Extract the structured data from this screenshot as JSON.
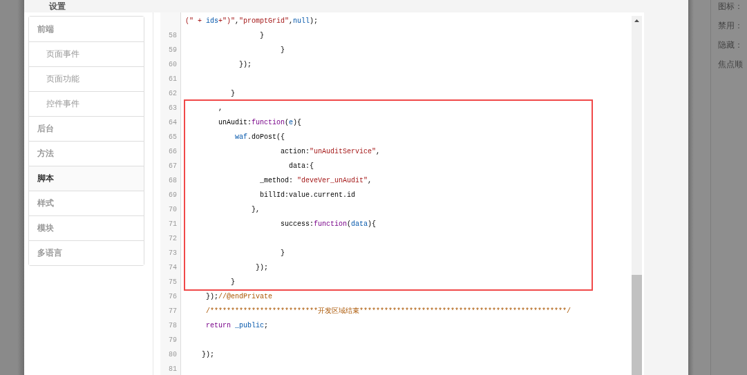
{
  "dialog": {
    "title": "设置"
  },
  "sidebar": {
    "items": [
      {
        "label": "前端",
        "selected": false,
        "children": [
          {
            "label": "页面事件",
            "selected": false
          },
          {
            "label": "页面功能",
            "selected": false
          },
          {
            "label": "控件事件",
            "selected": false
          }
        ]
      },
      {
        "label": "后台",
        "selected": false
      },
      {
        "label": "方法",
        "selected": false
      },
      {
        "label": "脚本",
        "selected": true
      },
      {
        "label": "样式",
        "selected": false
      },
      {
        "label": "模块",
        "selected": false
      },
      {
        "label": "多语言",
        "selected": false
      }
    ]
  },
  "editor": {
    "blocks": [
      {
        "highlighted": false,
        "lines": [
          {
            "segments": [
              {
                "kind": "string",
                "text": "(\" + "
              },
              {
                "kind": "ident",
                "text": "ids"
              },
              {
                "kind": "string",
                "text": "+\")\""
              },
              {
                "kind": "plain",
                "text": ","
              },
              {
                "kind": "string",
                "text": "\"promptGrid\""
              },
              {
                "kind": "plain",
                "text": ","
              },
              {
                "kind": "ident",
                "text": "null"
              },
              {
                "kind": "plain",
                "text": ");"
              }
            ]
          },
          {
            "number": "58",
            "segments": [
              {
                "kind": "plain",
                "text": "                  }"
              }
            ]
          },
          {
            "number": "59",
            "segments": [
              {
                "kind": "plain",
                "text": "                       }"
              }
            ]
          },
          {
            "number": "60",
            "segments": [
              {
                "kind": "plain",
                "text": "             });"
              }
            ]
          },
          {
            "number": "61"
          },
          {
            "number": "62",
            "segments": [
              {
                "kind": "plain",
                "text": "           }"
              }
            ]
          }
        ]
      },
      {
        "highlighted": true,
        "lines": [
          {
            "number": "63",
            "segments": [
              {
                "kind": "plain",
                "text": "        ,"
              }
            ]
          },
          {
            "number": "64",
            "segments": [
              {
                "kind": "plain",
                "text": "        unAudit:"
              },
              {
                "kind": "keyword",
                "text": "function"
              },
              {
                "kind": "plain",
                "text": "("
              },
              {
                "kind": "ident",
                "text": "e"
              },
              {
                "kind": "plain",
                "text": "){"
              }
            ]
          },
          {
            "number": "65",
            "segments": [
              {
                "kind": "ident",
                "text": "            waf"
              },
              {
                "kind": "plain",
                "text": ".doPost({"
              }
            ]
          },
          {
            "number": "66",
            "segments": [
              {
                "kind": "plain",
                "text": "                       action:"
              },
              {
                "kind": "string",
                "text": "\"unAuditService\""
              },
              {
                "kind": "plain",
                "text": ","
              }
            ]
          },
          {
            "number": "67",
            "segments": [
              {
                "kind": "plain",
                "text": "                         data:{"
              }
            ]
          },
          {
            "number": "68",
            "segments": [
              {
                "kind": "plain",
                "text": "                  _method: "
              },
              {
                "kind": "string",
                "text": "\"deveVer_unAudit\""
              },
              {
                "kind": "plain",
                "text": ","
              }
            ]
          },
          {
            "number": "69",
            "segments": [
              {
                "kind": "plain",
                "text": "                  billId:value.current.id"
              }
            ]
          },
          {
            "number": "70",
            "segments": [
              {
                "kind": "plain",
                "text": "                },"
              }
            ]
          },
          {
            "number": "71",
            "segments": [
              {
                "kind": "plain",
                "text": "                       success:"
              },
              {
                "kind": "keyword",
                "text": "function"
              },
              {
                "kind": "plain",
                "text": "("
              },
              {
                "kind": "ident",
                "text": "data"
              },
              {
                "kind": "plain",
                "text": "){"
              }
            ]
          },
          {
            "number": "72"
          },
          {
            "number": "73",
            "segments": [
              {
                "kind": "plain",
                "text": "                       }"
              }
            ]
          },
          {
            "number": "74",
            "segments": [
              {
                "kind": "plain",
                "text": "                 });"
              }
            ]
          },
          {
            "number": "75",
            "segments": [
              {
                "kind": "plain",
                "text": "           }"
              }
            ]
          }
        ]
      },
      {
        "highlighted": false,
        "lines": [
          {
            "number": "76",
            "segments": [
              {
                "kind": "plain",
                "text": "     });"
              },
              {
                "kind": "comment",
                "text": "//@endPrivate"
              }
            ]
          },
          {
            "number": "77",
            "segments": [
              {
                "kind": "comment",
                "text": "     /**************************开发区域结束**************************************************/"
              }
            ]
          },
          {
            "number": "78",
            "segments": [
              {
                "kind": "keyword",
                "text": "     return"
              },
              {
                "kind": "ident",
                "text": " _public"
              },
              {
                "kind": "plain",
                "text": ";"
              }
            ]
          },
          {
            "number": "79"
          },
          {
            "number": "80",
            "segments": [
              {
                "kind": "plain",
                "text": "    });"
              }
            ]
          },
          {
            "number": "81"
          }
        ]
      }
    ]
  },
  "side_panel": {
    "labels": [
      "图标：",
      "禁用：",
      "隐藏：",
      "焦点顺"
    ]
  }
}
